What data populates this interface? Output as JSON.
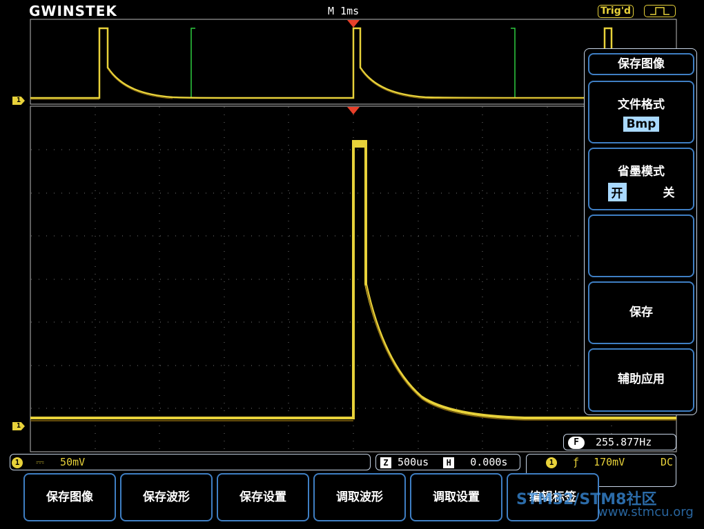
{
  "header": {
    "logo": "GWINSTEK",
    "timebase": "M 1ms",
    "trigger_status": "Trig'd"
  },
  "channel_marker": "1",
  "side_menu": {
    "title": "保存图像",
    "file_format_label": "文件格式",
    "file_format_value": "Bmp",
    "ink_saver_label": "省墨模式",
    "ink_saver_on": "开",
    "ink_saver_off": "关",
    "save_label": "保存",
    "assist_label": "辅助应用"
  },
  "frequency": {
    "badge": "F",
    "value": "255.877Hz"
  },
  "status": {
    "ch1_badge": "1",
    "ch1_coupling_symbol": "⎓",
    "ch1_scale": "50mV",
    "zoom_badge": "Z",
    "zoom_timebase": "500us",
    "h_badge": "H",
    "h_position": "0.000s",
    "trig_badge": "1",
    "trig_slope_symbol": "ƒ",
    "trig_level": "170mV",
    "trig_coupling": "DC"
  },
  "bottom_menu": [
    {
      "label": "保存图像"
    },
    {
      "label": "保存波形"
    },
    {
      "label": "保存设置"
    },
    {
      "label": "调取波形"
    },
    {
      "label": "调取设置"
    },
    {
      "label": "编辑标签"
    }
  ],
  "watermark": {
    "line1": "STM32/STM8社区",
    "line2": "www.stmcu.org"
  },
  "colors": {
    "trace": "#e8d23a",
    "zoom_window": "#2ecc40",
    "trigger_marker": "#e8402a",
    "button_border": "#3f7fc4",
    "highlight": "#a9d9ff"
  }
}
